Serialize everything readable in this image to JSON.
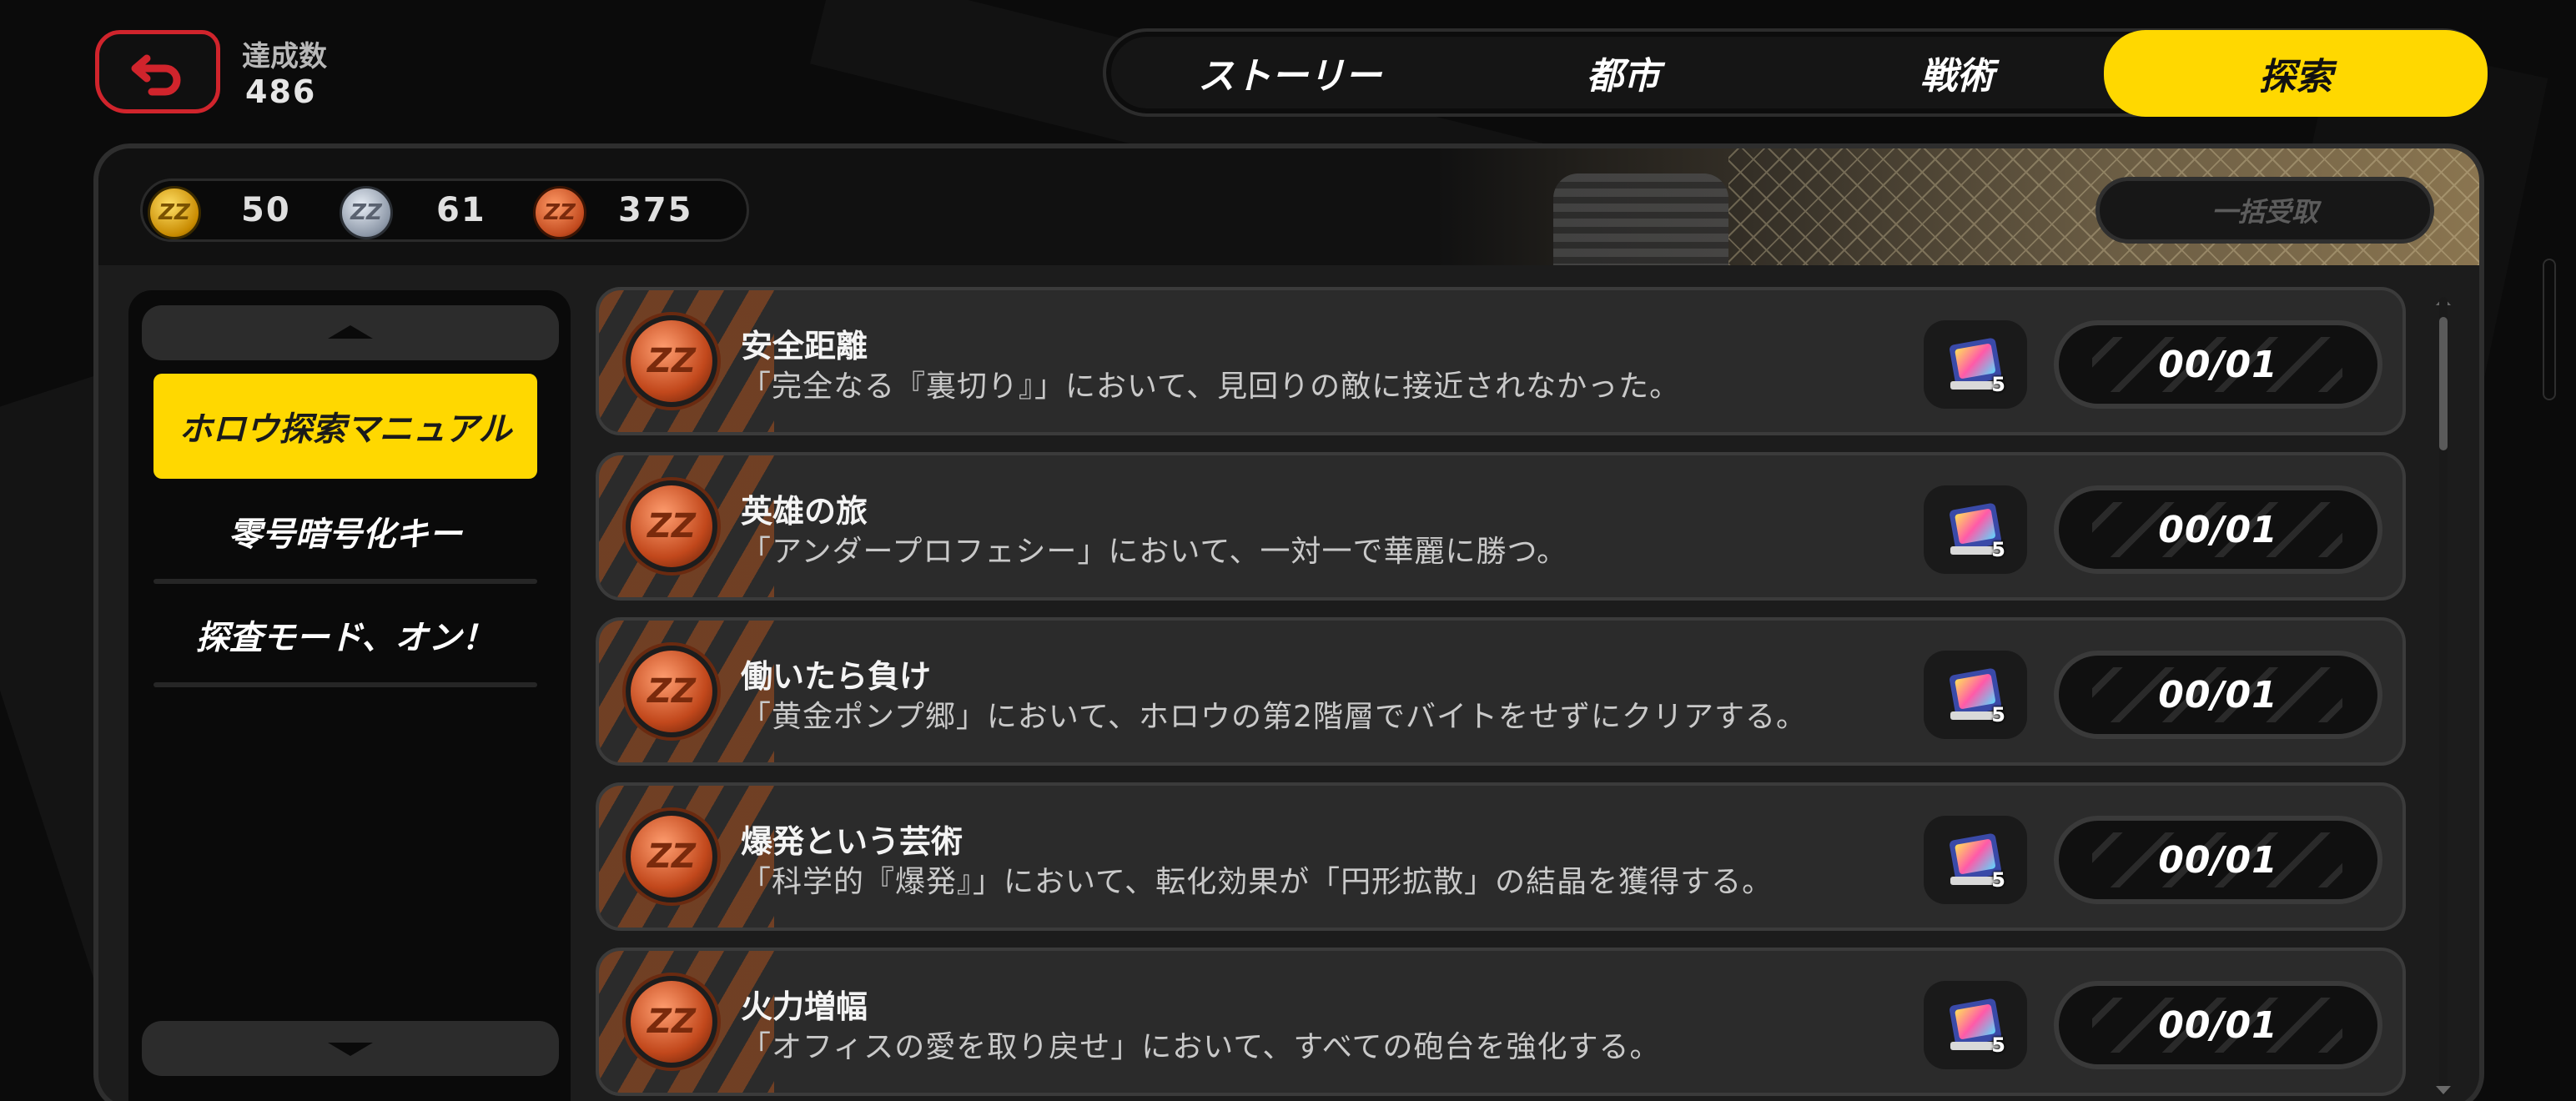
{
  "achievements": {
    "label": "達成数",
    "value": "486"
  },
  "tabs": [
    {
      "label": "ストーリー",
      "active": false
    },
    {
      "label": "都市",
      "active": false
    },
    {
      "label": "戦術",
      "active": false
    },
    {
      "label": "探索",
      "active": true
    }
  ],
  "currencies": [
    {
      "type": "gold",
      "icon": "gold-medal-icon",
      "count": "50"
    },
    {
      "type": "silver",
      "icon": "silver-medal-icon",
      "count": "61"
    },
    {
      "type": "bronze",
      "icon": "bronze-medal-icon",
      "count": "375"
    }
  ],
  "claim_all_label": "一括受取",
  "sidebar": {
    "items": [
      {
        "label": "ホロウ探索マニュアル",
        "active": true
      },
      {
        "label": "零号暗号化キー",
        "active": false
      },
      {
        "label": "探査モード、オン！",
        "active": false
      }
    ]
  },
  "achievement_list": [
    {
      "title": "安全距離",
      "description": "「完全なる『裏切り』」において、見回りの敵に接近されなかった。",
      "reward_count": "5",
      "progress": "00/01"
    },
    {
      "title": "英雄の旅",
      "description": "「アンダープロフェシー」において、一対一で華麗に勝つ。",
      "reward_count": "5",
      "progress": "00/01"
    },
    {
      "title": "働いたら負け",
      "description": "「黄金ポンプ郷」において、ホロウの第2階層でバイトをせずにクリアする。",
      "reward_count": "5",
      "progress": "00/01"
    },
    {
      "title": "爆発という芸術",
      "description": "「科学的『爆発』」において、転化効果が「円形拡散」の結晶を獲得する。",
      "reward_count": "5",
      "progress": "00/01"
    },
    {
      "title": "火力増幅",
      "description": "「オフィスの愛を取り戻せ」において、すべての砲台を強化する。",
      "reward_count": "5",
      "progress": "00/01"
    }
  ],
  "colors": {
    "accent": "#ffd800",
    "back_border": "#d0242c",
    "bronze": "#c2481c"
  }
}
